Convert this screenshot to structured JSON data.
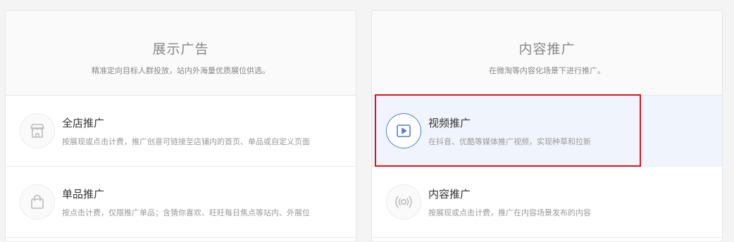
{
  "display_ads": {
    "title": "展示广告",
    "subtitle": "精准定向目标人群投放，站内外海量优质展位供选。",
    "items": [
      {
        "title": "全店推广",
        "desc": "按展现或点击计费，推广创意可链接至店铺内的首页、单品或自定义页面",
        "icon": "store-icon"
      },
      {
        "title": "单品推广",
        "desc": "按点击计费，仅限推广单品；含猜你喜欢、旺旺每日焦点等站内、外展位",
        "icon": "shopping-bag-icon"
      }
    ]
  },
  "content_promo": {
    "title": "内容推广",
    "subtitle": "在微淘等内容化场景下进行推广。",
    "items": [
      {
        "title": "视频推广",
        "desc": "在抖音、优酷等媒体推广视频，实现种草和拉新",
        "icon": "video-play-icon",
        "selected": true
      },
      {
        "title": "内容推广",
        "desc": "按展现或点击计费，推广在内容场景发布的内容",
        "icon": "broadcast-icon"
      }
    ]
  },
  "colors": {
    "accent": "#4a7ed9",
    "highlight_bg": "#f0f5fd",
    "selection_border": "#e0141c"
  }
}
